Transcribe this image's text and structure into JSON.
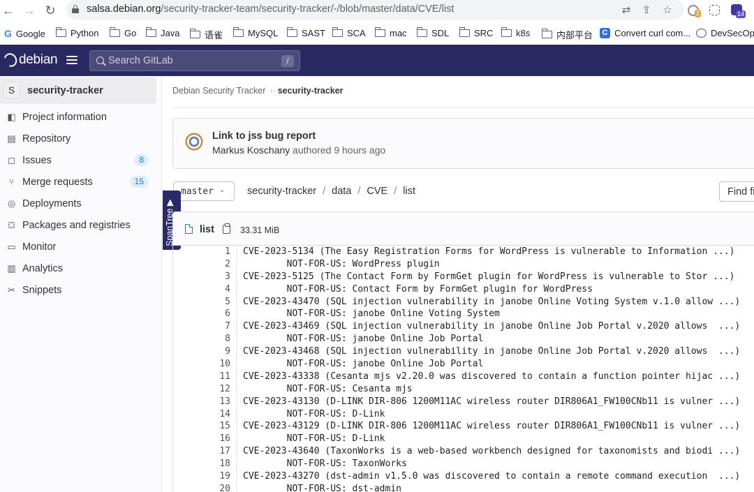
{
  "browser": {
    "url_host": "salsa.debian.org",
    "url_path": "/security-tracker-team/security-tracker/-/blob/master/data/CVE/list",
    "ext_badge_1": "2",
    "ext_badge_2": "14",
    "bookmarks": [
      "Google",
      "Python",
      "Go",
      "Java",
      "语雀",
      "MySQL",
      "SAST",
      "SCA",
      "mac",
      "SDL",
      "SRC",
      "k8s",
      "内部平台",
      "Convert curl com...",
      "DevSecOps"
    ]
  },
  "header": {
    "logo_text": "debian",
    "search_placeholder": "Search GitLab",
    "search_shortcut": "/"
  },
  "sidebar": {
    "project_avatar": "S",
    "project_name": "security-tracker",
    "items": [
      {
        "label": "Project information",
        "icon": "project-icon"
      },
      {
        "label": "Repository",
        "icon": "document-icon"
      },
      {
        "label": "Issues",
        "icon": "issues-icon",
        "count": "8"
      },
      {
        "label": "Merge requests",
        "icon": "merge-request-icon",
        "count": "15"
      },
      {
        "label": "Deployments",
        "icon": "rocket-icon"
      },
      {
        "label": "Packages and registries",
        "icon": "package-icon"
      },
      {
        "label": "Monitor",
        "icon": "monitor-icon"
      },
      {
        "label": "Analytics",
        "icon": "chart-icon"
      },
      {
        "label": "Snippets",
        "icon": "scissors-icon"
      }
    ]
  },
  "breadcrumb": {
    "parent": "Debian Security Tracker",
    "current": "security-tracker"
  },
  "commit": {
    "title": "Link to jss bug report",
    "author": "Markus Koschany",
    "action": "authored",
    "time": "9 hours ago"
  },
  "repo_nav": {
    "branch": "master",
    "path": [
      "security-tracker",
      "data",
      "CVE",
      "list"
    ],
    "find_file_label": "Find file"
  },
  "spantree_label": "SpanTree ▶",
  "file": {
    "name": "list",
    "size": "33.31 MiB",
    "lines": [
      {
        "n": "1",
        "text": "CVE-2023-5134 (The Easy Registration Forms for WordPress is vulnerable to Information ...)"
      },
      {
        "n": "2",
        "text": "\tNOT-FOR-US: WordPress plugin"
      },
      {
        "n": "3",
        "text": "CVE-2023-5125 (The Contact Form by FormGet plugin for WordPress is vulnerable to Stor ...)"
      },
      {
        "n": "4",
        "text": "\tNOT-FOR-US: Contact Form by FormGet plugin for WordPress"
      },
      {
        "n": "5",
        "text": "CVE-2023-43470 (SQL injection vulnerability in janobe Online Voting System v.1.0 allow ...)"
      },
      {
        "n": "6",
        "text": "\tNOT-FOR-US: janobe Online Voting System"
      },
      {
        "n": "7",
        "text": "CVE-2023-43469 (SQL injection vulnerability in janobe Online Job Portal v.2020 allows  ...)"
      },
      {
        "n": "8",
        "text": "\tNOT-FOR-US: janobe Online Job Portal"
      },
      {
        "n": "9",
        "text": "CVE-2023-43468 (SQL injection vulnerability in janobe Online Job Portal v.2020 allows  ...)"
      },
      {
        "n": "10",
        "text": "\tNOT-FOR-US: janobe Online Job Portal"
      },
      {
        "n": "11",
        "text": "CVE-2023-43338 (Cesanta mjs v2.20.0 was discovered to contain a function pointer hijac ...)"
      },
      {
        "n": "12",
        "text": "\tNOT-FOR-US: Cesanta mjs"
      },
      {
        "n": "13",
        "text": "CVE-2023-43130 (D-LINK DIR-806 1200M11AC wireless router DIR806A1_FW100CNb11 is vulner ...)"
      },
      {
        "n": "14",
        "text": "\tNOT-FOR-US: D-Link"
      },
      {
        "n": "15",
        "text": "CVE-2023-43129 (D-LINK DIR-806 1200M11AC wireless router DIR806A1_FW100CNb11 is vulner ...)"
      },
      {
        "n": "16",
        "text": "\tNOT-FOR-US: D-Link"
      },
      {
        "n": "17",
        "text": "CVE-2023-43640 (TaxonWorks is a web-based workbench designed for taxonomists and biodi ...)"
      },
      {
        "n": "18",
        "text": "\tNOT-FOR-US: TaxonWorks"
      },
      {
        "n": "19",
        "text": "CVE-2023-43270 (dst-admin v1.5.0 was discovered to contain a remote command execution  ...)"
      },
      {
        "n": "20",
        "text": "\tNOT-FOR-US: dst-admin"
      }
    ]
  }
}
